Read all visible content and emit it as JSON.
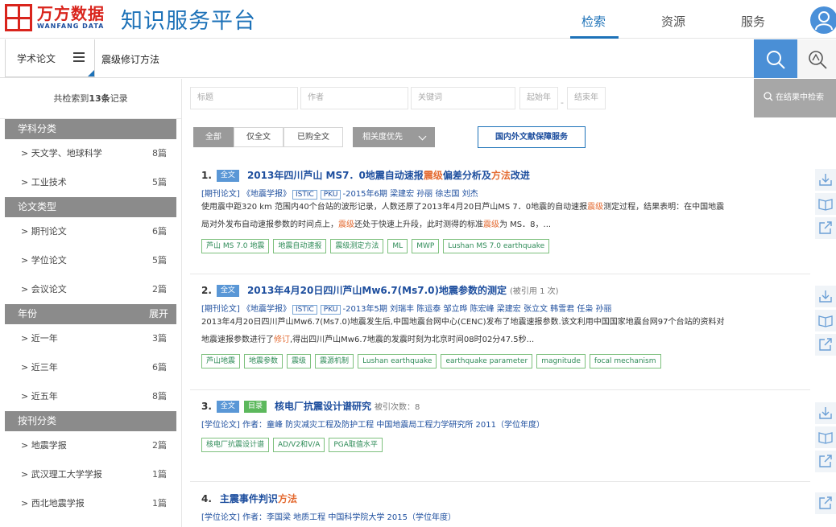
{
  "header": {
    "logo_cn": "万方数据",
    "logo_en": "WANFANG DATA",
    "platform_title": "知识服务平台",
    "nav": [
      {
        "label": "检索",
        "active": true
      },
      {
        "label": "资源",
        "active": false
      },
      {
        "label": "服务",
        "active": false
      }
    ]
  },
  "search": {
    "scope": "学术论文",
    "query": "震级修订方法"
  },
  "sidebar": {
    "count_prefix": "共检索到",
    "count_value": "13条",
    "count_suffix": "记录",
    "facets": [
      {
        "title": "学科分类",
        "expand": "",
        "items": [
          {
            "label": "> 天文学、地球科学",
            "count": "8篇"
          },
          {
            "label": "> 工业技术",
            "count": "5篇"
          }
        ]
      },
      {
        "title": "论文类型",
        "expand": "",
        "items": [
          {
            "label": "> 期刊论文",
            "count": "6篇"
          },
          {
            "label": "> 学位论文",
            "count": "5篇"
          },
          {
            "label": "> 会议论文",
            "count": "2篇"
          }
        ]
      },
      {
        "title": "年份",
        "expand": "展开",
        "items": [
          {
            "label": "> 近一年",
            "count": "3篇"
          },
          {
            "label": "> 近三年",
            "count": "6篇"
          },
          {
            "label": "> 近五年",
            "count": "8篇"
          }
        ]
      },
      {
        "title": "按刊分类",
        "expand": "",
        "items": [
          {
            "label": "> 地震学报",
            "count": "2篇"
          },
          {
            "label": "> 武汉理工大学学报",
            "count": "1篇"
          },
          {
            "label": "> 西北地震学报",
            "count": "1篇"
          }
        ]
      }
    ]
  },
  "filters": {
    "title_placeholder": "标题",
    "author_placeholder": "作者",
    "keyword_placeholder": "关键词",
    "start_year_placeholder": "起始年",
    "end_year_placeholder": "结束年",
    "dash": "-",
    "within_search": "在结果中检索"
  },
  "sort": {
    "tabs": [
      "全部",
      "仅全文",
      "已购全文"
    ],
    "active_tab": 0,
    "order": "相关度优先",
    "guarantee": "国内外文献保障服务"
  },
  "results": [
    {
      "num": "1.",
      "badges": [
        {
          "text": "全文",
          "color": "blue"
        }
      ],
      "title_parts": [
        {
          "text": "2013年四川芦山 MS7．0地震自动速报",
          "hl": false
        },
        {
          "text": "震级",
          "hl": true
        },
        {
          "text": "偏差分析及",
          "hl": false
        },
        {
          "text": "方法",
          "hl": true
        },
        {
          "text": "改进",
          "hl": false
        }
      ],
      "title_extra": "",
      "meta_parts": [
        {
          "text": "[期刊论文] 《地震学报》",
          "box": false
        },
        {
          "text": "ISTIC",
          "box": true
        },
        {
          "text": "PKU",
          "box": true
        },
        {
          "text": "-2015年6期 梁建宏 孙丽 徐志国 刘杰",
          "box": false
        }
      ],
      "abstract_lines": [
        [
          {
            "text": "使用震中距320 km 范围内40个台站的波形记录，人数还原了2013年4月20日芦山MS 7．0地震的自动速报",
            "hl": false
          },
          {
            "text": "震级",
            "hl": true
          },
          {
            "text": "测定过程，结果表明：在中国地震",
            "hl": false
          }
        ],
        [
          {
            "text": "局对外发布自动速报参数的时间点上，",
            "hl": false
          },
          {
            "text": "震级",
            "hl": true
          },
          {
            "text": "还处于快速上升段，此时测得的标准",
            "hl": false
          },
          {
            "text": "震级",
            "hl": true
          },
          {
            "text": "为 MS．8，...",
            "hl": false
          }
        ]
      ],
      "keywords": [
        "芦山 MS 7.0 地震",
        "地震自动速报",
        "震级测定方法",
        "ML",
        "MWP",
        "Lushan MS 7.0 earthquake"
      ]
    },
    {
      "num": "2.",
      "badges": [
        {
          "text": "全文",
          "color": "blue"
        }
      ],
      "title_parts": [
        {
          "text": "2013年4月20日四川芦山Mw6.7(Ms7.0)地震参数的测定",
          "hl": false
        }
      ],
      "title_extra": "(被引用 1 次)",
      "meta_parts": [
        {
          "text": "[期刊论文] 《地震学报》",
          "box": false
        },
        {
          "text": "ISTIC",
          "box": true
        },
        {
          "text": "PKU",
          "box": true
        },
        {
          "text": "-2013年5期 刘瑞丰 陈运泰 邹立晔 陈宏峰 梁建宏 张立文 韩雪君 任枭 孙丽",
          "box": false
        }
      ],
      "abstract_lines": [
        [
          {
            "text": "2013年4月20日四川芦山Mw6.7(Ms7.0)地震发生后,中国地震台网中心(CENC)发布了地震速报参数.该文利用中国国家地震台网97个台站的资料对",
            "hl": false
          }
        ],
        [
          {
            "text": "地震速报参数进行了",
            "hl": false
          },
          {
            "text": "修订",
            "hl": true
          },
          {
            "text": ",得出四川芦山Mw6.7地震的发震时刻为北京时间08时02分47.5秒...",
            "hl": false
          }
        ]
      ],
      "keywords": [
        "芦山地震",
        "地震参数",
        "震级",
        "震源机制",
        "Lushan earthquake",
        "earthquake parameter",
        "magnitude",
        "focal mechanism"
      ]
    },
    {
      "num": "3.",
      "badges": [
        {
          "text": "全文",
          "color": "blue"
        },
        {
          "text": "目录",
          "color": "green"
        }
      ],
      "title_parts": [
        {
          "text": "核电厂抗震设计谱研究",
          "hl": false
        }
      ],
      "title_extra": "被引次数：8",
      "meta_parts": [
        {
          "text": "[学位论文] 作者：童峰  防灾减灾工程及防护工程  中国地震局工程力学研究所 2011（学位年度）",
          "box": false
        }
      ],
      "abstract_lines": [],
      "keywords": [
        "核电厂抗震设计谱",
        "AD/V2和V/A",
        "PGA取值水平"
      ]
    },
    {
      "num": "4.",
      "badges": [],
      "title_parts": [
        {
          "text": "主震事件判识",
          "hl": false
        },
        {
          "text": "方法",
          "hl": true
        }
      ],
      "title_extra": "",
      "meta_parts": [
        {
          "text": "[学位论文] 作者：李国梁  地质工程  中国科学院大学 2015（学位年度）",
          "box": false
        }
      ],
      "abstract_lines": [],
      "keywords": []
    }
  ]
}
